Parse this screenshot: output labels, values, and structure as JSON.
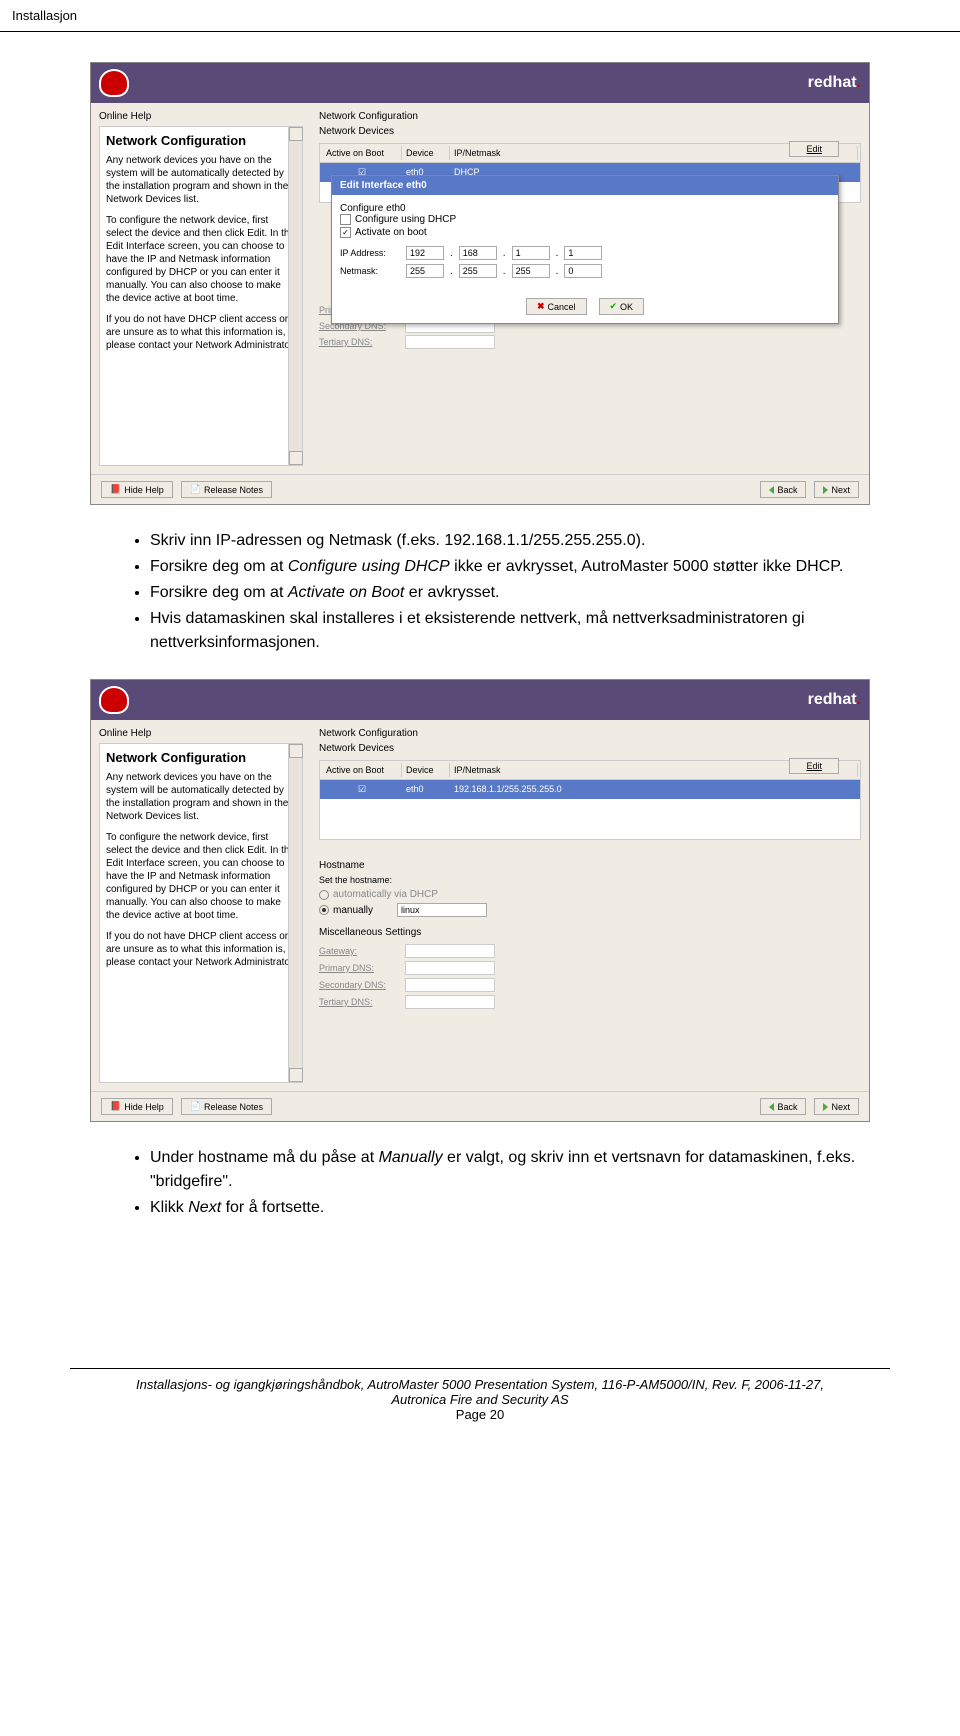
{
  "pageHeader": "Installasjon",
  "screenshot1": {
    "brand": "redhat",
    "leftTitle": "Online Help",
    "panelHeading": "Network Configuration",
    "para1": "Any network devices you have on the system will be automatically detected by the installation program and shown in the Network Devices list.",
    "para2": "To configure the network device, first select the device and then click Edit. In the Edit Interface screen, you can choose to have the IP and Netmask information configured by DHCP or you can enter it manually. You can also choose to make the device active at boot time.",
    "para3": "If you do not have DHCP client access or are unsure as to what this information is, please contact your Network Administrator.",
    "rightTitle": "Network Configuration",
    "devicesLabel": "Network Devices",
    "tableHdr": {
      "c1": "Active on Boot",
      "c2": "Device",
      "c3": "IP/Netmask"
    },
    "tableRow": {
      "c2": "eth0",
      "c3": "DHCP"
    },
    "editLabel": "Edit",
    "dialogTitle": "Edit Interface eth0",
    "configLabel": "Configure eth0",
    "cb1": "Configure using DHCP",
    "cb2": "Activate on boot",
    "ipLabel": "IP Address:",
    "nmLabel": "Netmask:",
    "ip": [
      "192",
      "168",
      "1",
      "1"
    ],
    "nm": [
      "255",
      "255",
      "255",
      "0"
    ],
    "cancel": "Cancel",
    "ok": "OK",
    "dns1": "Primary DNS:",
    "dns2": "Secondary DNS:",
    "dns3": "Tertiary DNS:",
    "hideHelp": "Hide Help",
    "releaseNotes": "Release Notes",
    "back": "Back",
    "next": "Next"
  },
  "bullets1": {
    "b1a": "Skriv inn IP-adressen og Netmask (f.eks. 192.168.1.1/255.255.255.0).",
    "b2a": "Forsikre deg om at ",
    "b2b": "Configure using DHCP",
    "b2c": " ikke er avkrysset, AutroMaster 5000 støtter ikke DHCP.",
    "b3a": "Forsikre deg om at ",
    "b3b": "Activate on Boot",
    "b3c": " er avkrysset.",
    "b4": "Hvis datamaskinen skal installeres i et eksisterende nettverk, må nettverksadministratoren gi nettverksinformasjonen."
  },
  "screenshot2": {
    "tableRow": {
      "c2": "eth0",
      "c3": "192.168.1.1/255.255.255.0"
    },
    "hostnameTitle": "Hostname",
    "setHostname": "Set the hostname:",
    "autoOpt": "automatically via DHCP",
    "manualOpt": "manually",
    "manualVal": "linux",
    "miscTitle": "Miscellaneous Settings",
    "gateway": "Gateway:"
  },
  "bullets2": {
    "b1a": "Under hostname må du påse at ",
    "b1b": "Manually",
    "b1c": " er valgt, og skriv inn et vertsnavn for datamaskinen, f.eks. \"bridgefire\".",
    "b2a": "Klikk ",
    "b2b": "Next",
    "b2c": " for å fortsette."
  },
  "footer": {
    "line1a": "Installasjons- og igangkjøringshåndbok, AutroMaster 5000 Presentation System, 116-P-AM5000/IN, Rev. F, 2006-11-27,",
    "line1b": "Autronica Fire and Security AS",
    "pageNum": "Page 20"
  }
}
